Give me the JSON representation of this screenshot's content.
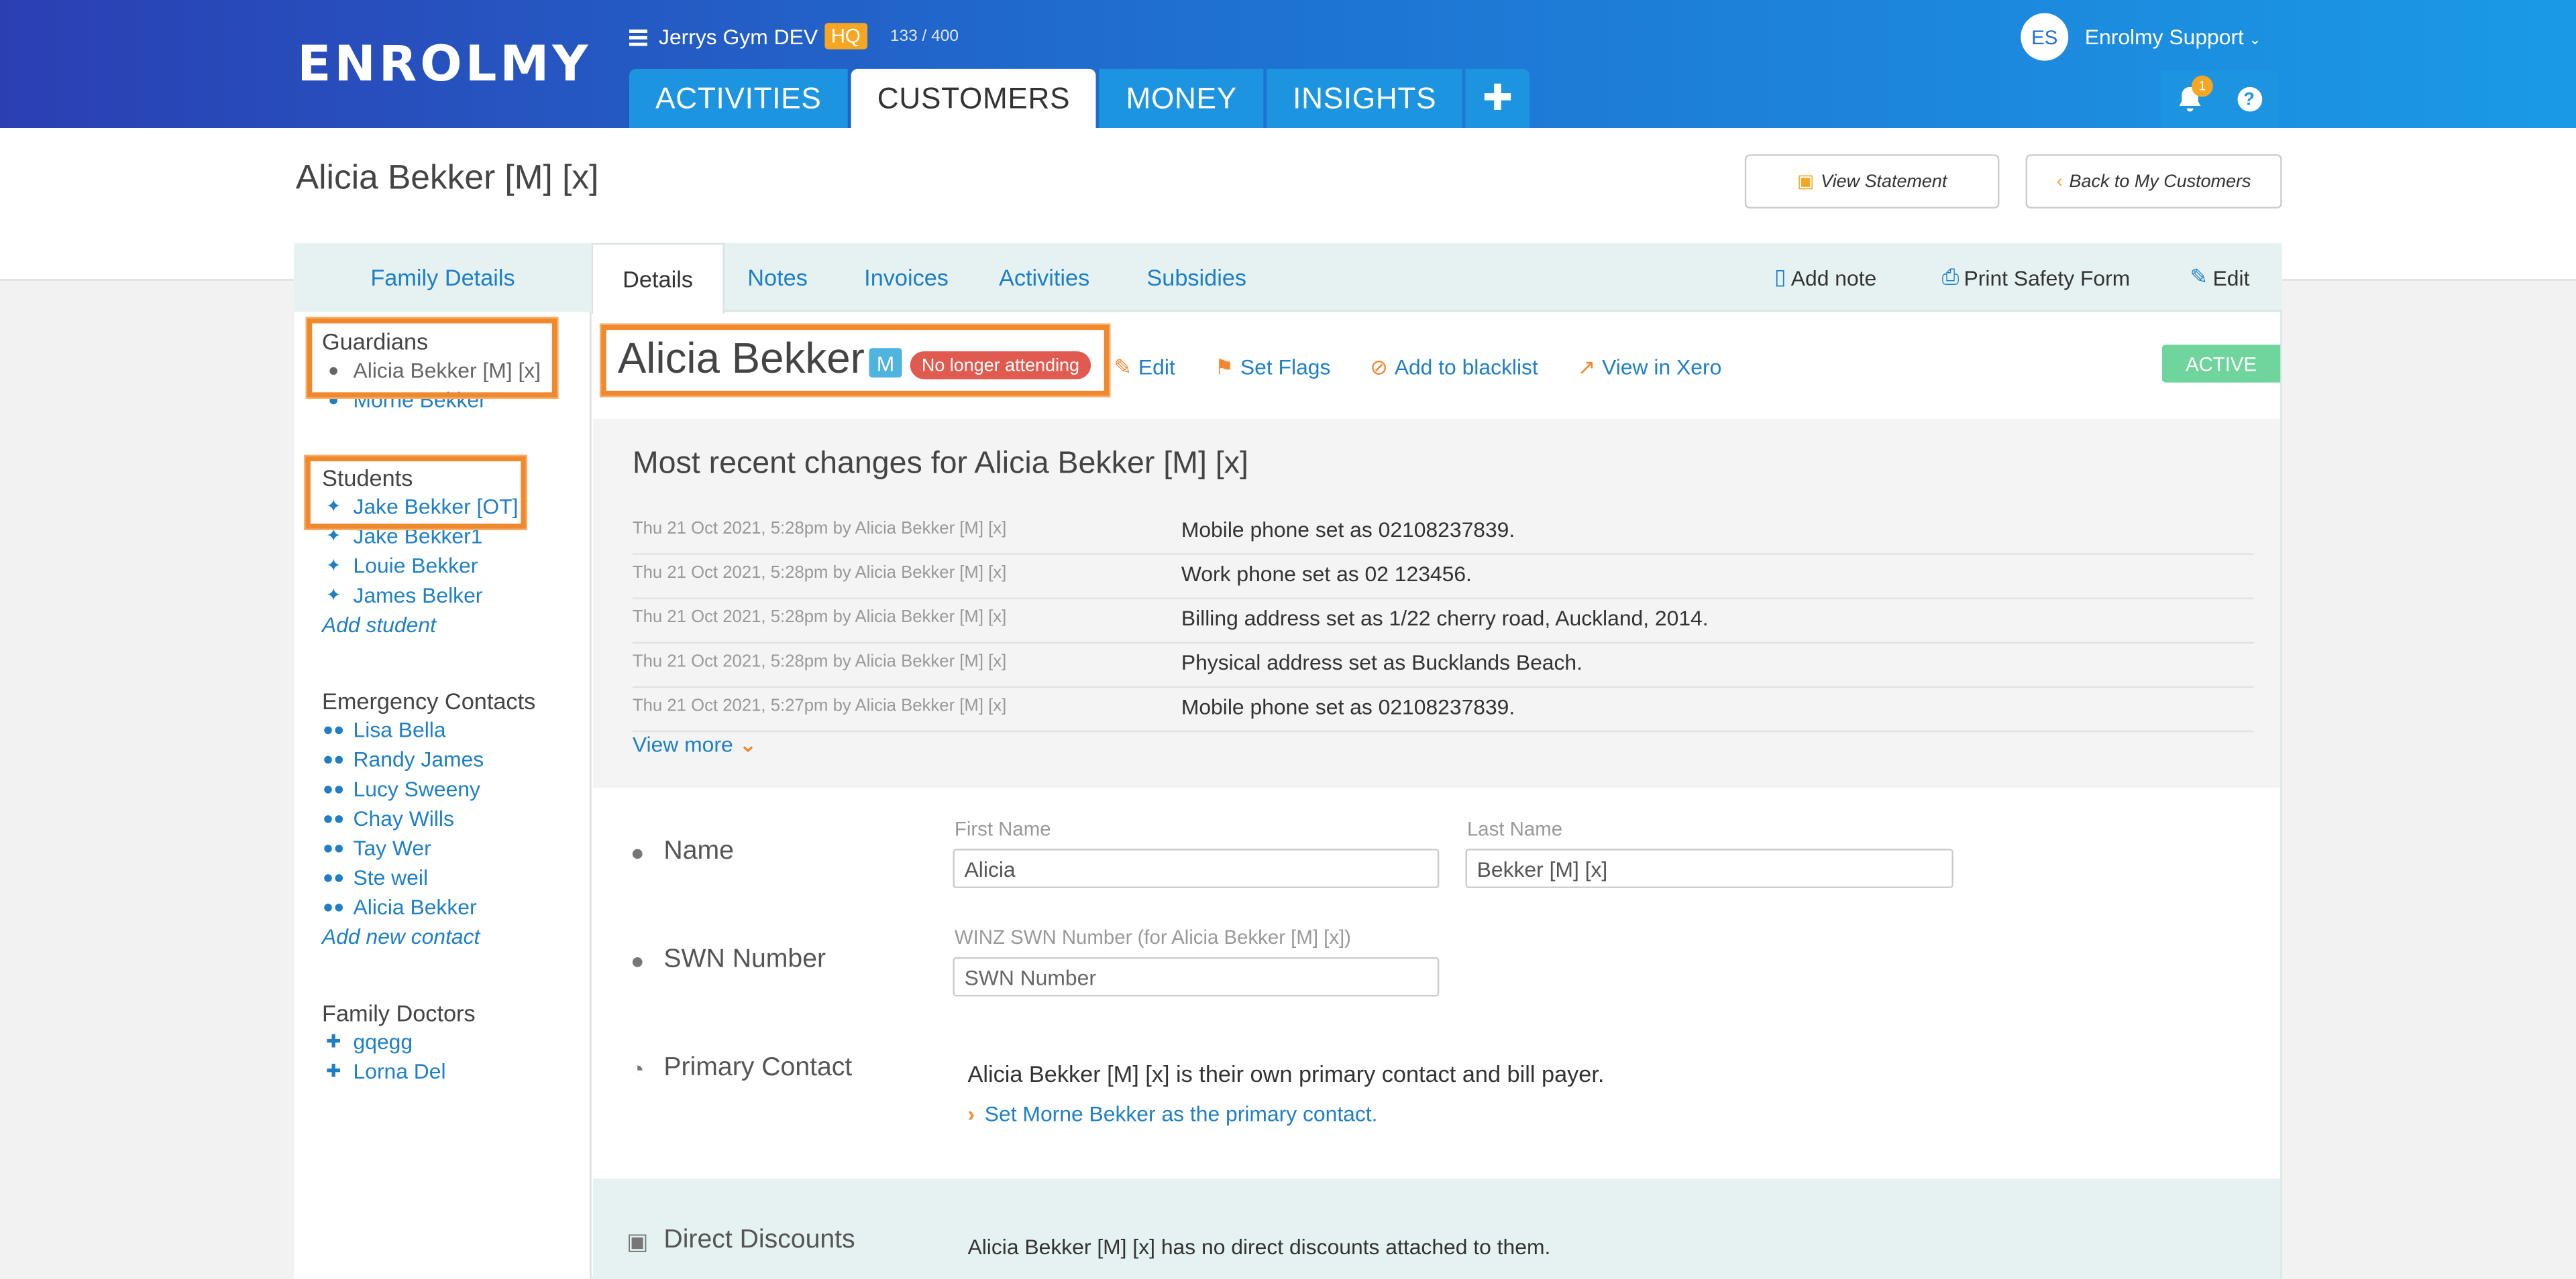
{
  "header": {
    "logo": "ENROLMY",
    "site_name": "Jerrys Gym DEV",
    "site_badge": "HQ",
    "counter": "133 / 400",
    "nav": [
      "ACTIVITIES",
      "CUSTOMERS",
      "MONEY",
      "INSIGHTS"
    ],
    "nav_active": "CUSTOMERS",
    "plus": "✚",
    "avatar_initials": "ES",
    "user_name": "Enrolmy Support",
    "bell_count": "1",
    "help": "?"
  },
  "page": {
    "title": "Alicia Bekker [M] [x]",
    "view_statement": "View Statement",
    "back": "Back to My Customers"
  },
  "tabs": {
    "family": "Family Details",
    "items": [
      "Details",
      "Notes",
      "Invoices",
      "Activities",
      "Subsidies"
    ],
    "actions": {
      "add_note": "Add note",
      "print": "Print Safety Form",
      "edit": "Edit"
    }
  },
  "sidebar": {
    "guardians_title": "Guardians",
    "guardians": [
      "Alicia Bekker [M] [x]",
      "Morne Bekker"
    ],
    "students_title": "Students",
    "students": [
      "Jake Bekker [OT]",
      "Jake Bekker1",
      "Louie Bekker",
      "James Belker"
    ],
    "add_student": "Add student",
    "contacts_title": "Emergency Contacts",
    "contacts": [
      "Lisa Bella",
      "Randy James",
      "Lucy Sweeny",
      "Chay Wills",
      "Tay Wer",
      "Ste weil",
      "Alicia Bekker"
    ],
    "add_contact": "Add new contact",
    "doctors_title": "Family Doctors",
    "doctors": [
      "gqegg",
      "Lorna Del"
    ]
  },
  "customer": {
    "name": "Alicia Bekker",
    "m_badge": "M",
    "status_badge": "No longer attending",
    "actions": {
      "edit": "Edit",
      "flags": "Set Flags",
      "blacklist": "Add to blacklist",
      "xero": "View in Xero"
    },
    "active": "ACTIVE"
  },
  "changes": {
    "title": "Most recent changes for Alicia Bekker [M] [x]",
    "rows": [
      {
        "meta": "Thu 21 Oct 2021, 5:28pm by Alicia Bekker [M] [x]",
        "text": "Mobile phone set as 02108237839."
      },
      {
        "meta": "Thu 21 Oct 2021, 5:28pm by Alicia Bekker [M] [x]",
        "text": "Work phone set as 02 123456."
      },
      {
        "meta": "Thu 21 Oct 2021, 5:28pm by Alicia Bekker [M] [x]",
        "text": "Billing address set as 1/22 cherry road, Auckland, 2014."
      },
      {
        "meta": "Thu 21 Oct 2021, 5:28pm by Alicia Bekker [M] [x]",
        "text": "Physical address set as Bucklands Beach."
      },
      {
        "meta": "Thu 21 Oct 2021, 5:27pm by Alicia Bekker [M] [x]",
        "text": "Mobile phone set as 02108237839."
      }
    ],
    "view_more": "View more"
  },
  "form": {
    "name_label": "Name",
    "first_label": "First Name",
    "first_value": "Alicia",
    "last_label": "Last Name",
    "last_value": "Bekker [M] [x]",
    "swn_label": "SWN Number",
    "swn_field_label": "WINZ SWN Number (for Alicia Bekker [M] [x])",
    "swn_placeholder": "SWN Number",
    "pc_label": "Primary Contact",
    "pc_text": "Alicia Bekker [M] [x] is their own primary contact and bill payer.",
    "pc_link": "Set Morne Bekker as the primary contact.",
    "disc_label": "Direct Discounts",
    "disc_text": "Alicia Bekker [M] [x] has no direct discounts attached to them."
  },
  "colors": {
    "accent": "#1e7fc6",
    "highlight": "#f0882e",
    "active": "#6fd59c",
    "danger": "#e05a4f"
  }
}
